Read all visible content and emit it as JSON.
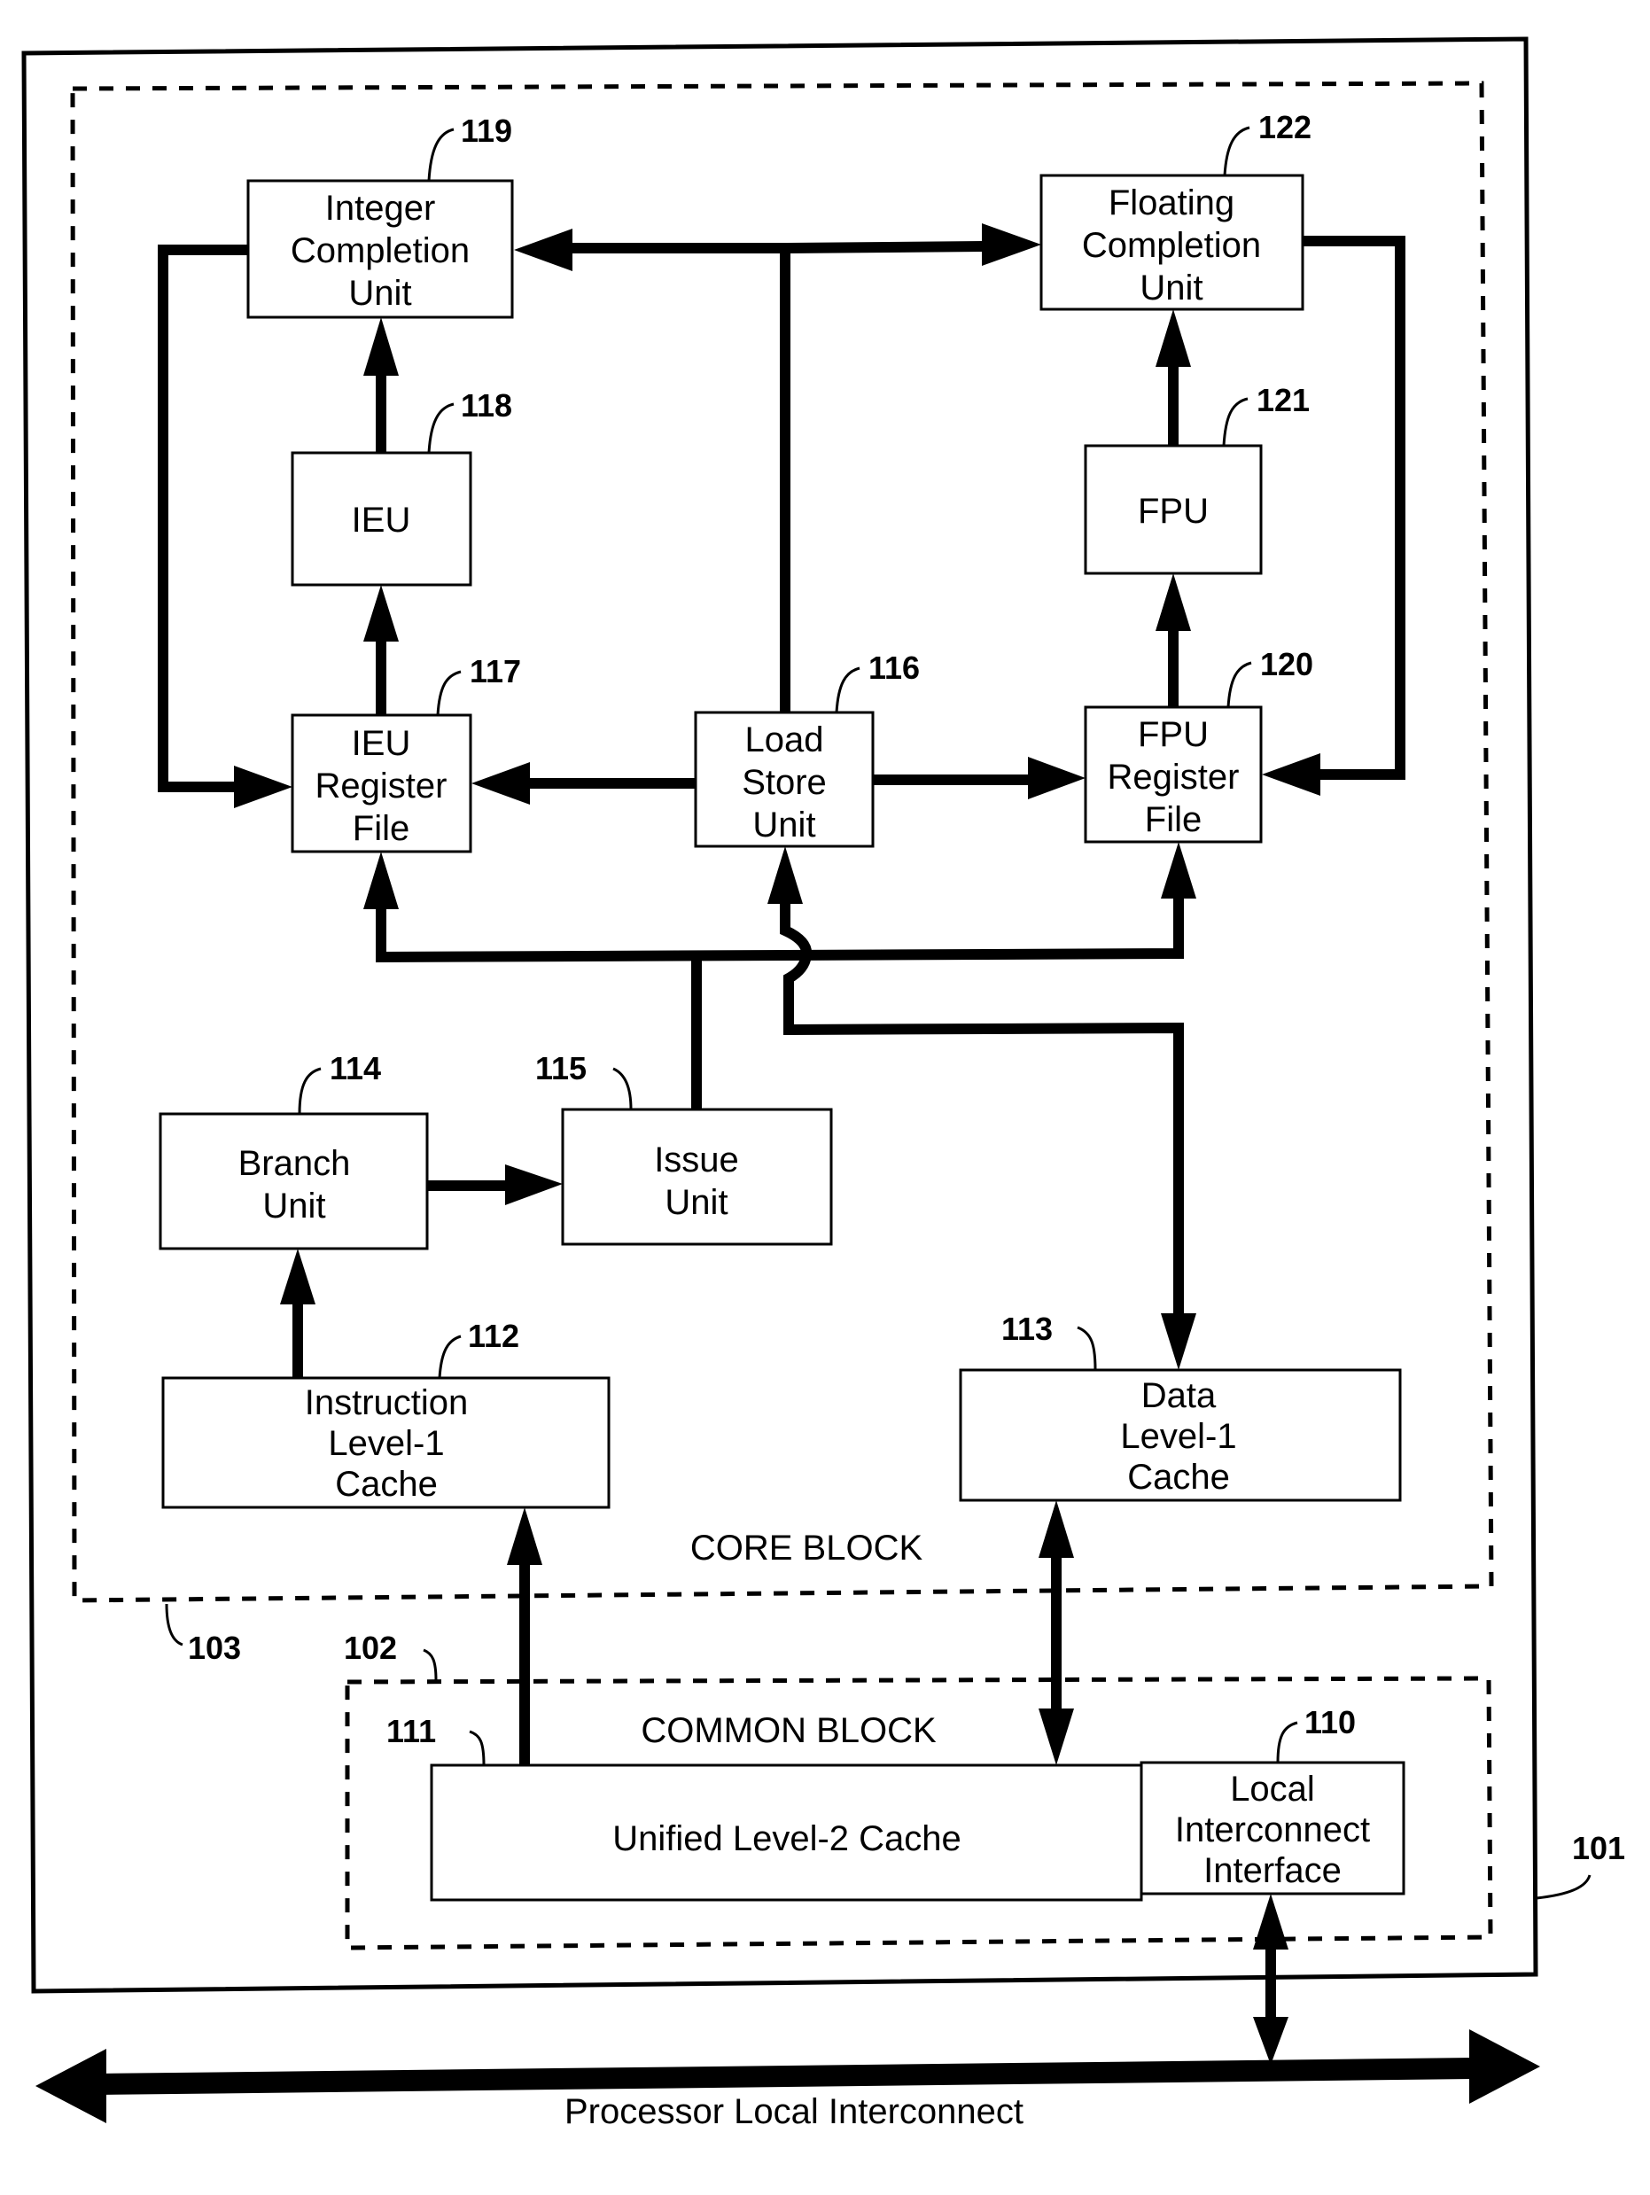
{
  "figure": {
    "refs": {
      "processor": "101",
      "common_block": "102",
      "core_block": "103"
    },
    "block_labels": {
      "core": "CORE BLOCK",
      "common": "COMMON BLOCK"
    },
    "bus_label": "Processor Local Interconnect"
  },
  "units": {
    "integer_completion": {
      "ref": "119",
      "lines": [
        "Integer",
        "Completion",
        "Unit"
      ]
    },
    "floating_completion": {
      "ref": "122",
      "lines": [
        "Floating",
        "Completion",
        "Unit"
      ]
    },
    "ieu": {
      "ref": "118",
      "lines": [
        "IEU"
      ]
    },
    "fpu": {
      "ref": "121",
      "lines": [
        "FPU"
      ]
    },
    "ieu_register_file": {
      "ref": "117",
      "lines": [
        "IEU",
        "Register",
        "File"
      ]
    },
    "load_store": {
      "ref": "116",
      "lines": [
        "Load",
        "Store",
        "Unit"
      ]
    },
    "fpu_register_file": {
      "ref": "120",
      "lines": [
        "FPU",
        "Register",
        "File"
      ]
    },
    "branch": {
      "ref": "114",
      "lines": [
        "Branch",
        "Unit"
      ]
    },
    "issue": {
      "ref": "115",
      "lines": [
        "Issue",
        "Unit"
      ]
    },
    "instruction_l1": {
      "ref": "112",
      "lines": [
        "Instruction",
        "Level-1",
        "Cache"
      ]
    },
    "data_l1": {
      "ref": "113",
      "lines": [
        "Data",
        "Level-1",
        "Cache"
      ]
    },
    "unified_l2": {
      "ref": "111",
      "lines": [
        "Unified Level-2 Cache"
      ]
    },
    "local_interconnect_interface": {
      "ref": "110",
      "lines": [
        "Local",
        "Interconnect",
        "Interface"
      ]
    }
  }
}
